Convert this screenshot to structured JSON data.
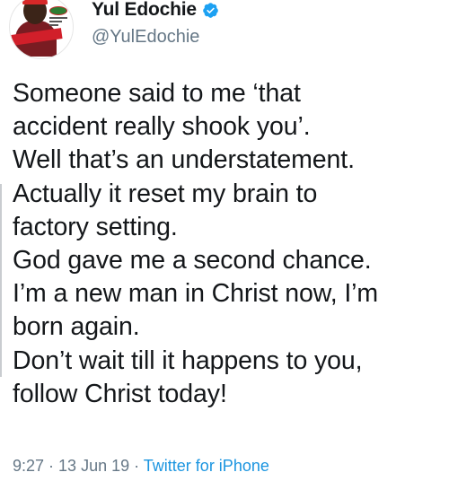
{
  "user": {
    "display_name": "Yul Edochie",
    "handle": "@YulEdochie",
    "verified": true,
    "verified_color": "#1da1f2",
    "avatar_icon": "profile-photo"
  },
  "tweet": {
    "lines": [
      "Someone said to me ‘that",
      "accident really shook you’.",
      "Well that’s an understatement.",
      "Actually it reset my brain to",
      "factory setting.",
      "God gave me a second chance.",
      "I’m a new man in Christ now, I’m",
      "born again.",
      "Don’t wait till it happens to you,",
      "follow Christ today!"
    ]
  },
  "meta": {
    "time": "9:27",
    "separator": " · ",
    "date": "13 Jun 19",
    "source": "Twitter for iPhone",
    "source_color": "#1b95e0",
    "text_color": "#657786"
  }
}
